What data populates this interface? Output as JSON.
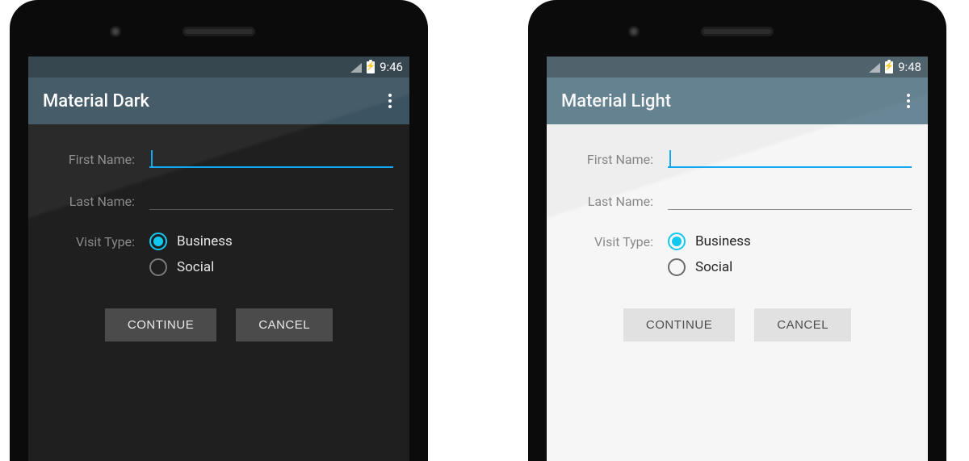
{
  "phones": {
    "dark": {
      "status": {
        "time": "9:46"
      },
      "appbar": {
        "title": "Material Dark"
      },
      "form": {
        "first_name_label": "First Name:",
        "last_name_label": "Last Name:",
        "visit_type_label": "Visit Type:",
        "options": {
          "business": "Business",
          "social": "Social"
        }
      },
      "buttons": {
        "continue": "CONTINUE",
        "cancel": "CANCEL"
      }
    },
    "light": {
      "status": {
        "time": "9:48"
      },
      "appbar": {
        "title": "Material Light"
      },
      "form": {
        "first_name_label": "First Name:",
        "last_name_label": "Last Name:",
        "visit_type_label": "Visit Type:",
        "options": {
          "business": "Business",
          "social": "Social"
        }
      },
      "buttons": {
        "continue": "CONTINUE",
        "cancel": "CANCEL"
      }
    }
  },
  "colors": {
    "accent": "#12a7f1",
    "dark_bg": "#1f1f1f",
    "light_bg": "#f6f6f6",
    "dark_appbar": "#3c5361",
    "light_appbar": "#688695"
  }
}
